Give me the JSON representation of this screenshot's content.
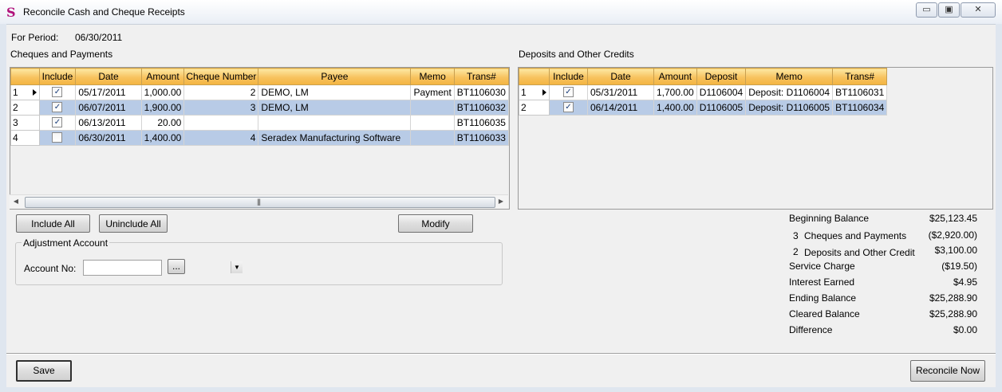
{
  "window": {
    "title": "Reconcile Cash and Cheque Receipts",
    "icon_glyph": "S",
    "controls": {
      "minimize": "▭",
      "restore": "▣",
      "close": "✕"
    }
  },
  "period": {
    "label": "For Period:",
    "value": "06/30/2011"
  },
  "cheques": {
    "title": "Cheques and Payments",
    "columns": [
      "Include",
      "Date",
      "Amount",
      "Cheque Number",
      "Payee",
      "Memo",
      "Trans#"
    ],
    "rows": [
      {
        "num": "1",
        "include": true,
        "date": "05/17/2011",
        "amount": "1,000.00",
        "cheque": "2",
        "payee": "DEMO, LM",
        "memo": "Payment",
        "trans": "BT1106030"
      },
      {
        "num": "2",
        "include": true,
        "date": "06/07/2011",
        "amount": "1,900.00",
        "cheque": "3",
        "payee": "DEMO, LM",
        "memo": "",
        "trans": "BT1106032"
      },
      {
        "num": "3",
        "include": true,
        "date": "06/13/2011",
        "amount": "20.00",
        "cheque": "",
        "payee": "",
        "memo": "",
        "trans": "BT1106035"
      },
      {
        "num": "4",
        "include": false,
        "date": "06/30/2011",
        "amount": "1,400.00",
        "cheque": "4",
        "payee": "Seradex Manufacturing Software",
        "memo": "",
        "trans": "BT1106033"
      }
    ]
  },
  "deposits": {
    "title": "Deposits and Other Credits",
    "columns": [
      "Include",
      "Date",
      "Amount",
      "Deposit",
      "Memo",
      "Trans#"
    ],
    "rows": [
      {
        "num": "1",
        "include": true,
        "date": "05/31/2011",
        "amount": "1,700.00",
        "deposit": "D1106004",
        "memo": "Deposit: D1106004",
        "trans": "BT1106031"
      },
      {
        "num": "2",
        "include": true,
        "date": "06/14/2011",
        "amount": "1,400.00",
        "deposit": "D1106005",
        "memo": "Deposit: D1106005",
        "trans": "BT1106034"
      }
    ]
  },
  "buttons": {
    "include_all": "Include All",
    "uninclude_all": "Uninclude All",
    "modify": "Modify",
    "browse": "...",
    "save": "Save",
    "reconcile_now": "Reconcile Now"
  },
  "adjustment": {
    "title": "Adjustment Account",
    "account_label": "Account No:",
    "account_value": ""
  },
  "summary": {
    "beginning_label": "Beginning Balance",
    "beginning_value": "$25,123.45",
    "cheques_count": "3",
    "cheques_label": "Cheques and Payments",
    "cheques_value": "($2,920.00)",
    "deposits_count": "2",
    "deposits_label": "Deposits and Other Credit",
    "deposits_value": "$3,100.00",
    "service_label": "Service Charge",
    "service_value": "($19.50)",
    "interest_label": "Interest Earned",
    "interest_value": "$4.95",
    "ending_label": "Ending Balance",
    "ending_value": "$25,288.90",
    "cleared_label": "Cleared Balance",
    "cleared_value": "$25,288.90",
    "difference_label": "Difference",
    "difference_value": "$0.00"
  },
  "scrollbar": {
    "left_arrow": "◀",
    "right_arrow": "▶",
    "grip": "|||"
  },
  "checkmark": "✓",
  "combo_arrow": "▼"
}
